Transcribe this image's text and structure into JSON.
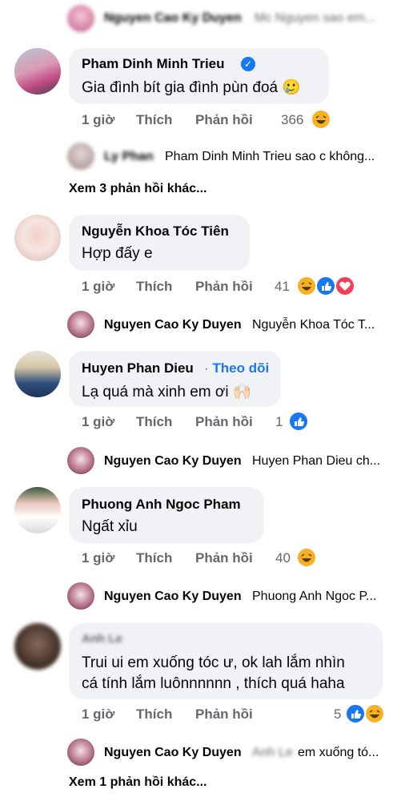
{
  "top_reply": {
    "name": "Nguyen Cao Ky Duyen",
    "text": "Mc Nguyen sao em..."
  },
  "comments": [
    {
      "name": "Pham Dinh Minh Trieu",
      "verified": true,
      "text": "Gia đình bít gia đình pùn đoá 🥲",
      "time": "1 giờ",
      "like": "Thích",
      "reply": "Phản hồi",
      "count": "366",
      "reply_preview": {
        "name": "Ly Phan",
        "text": "Pham Dinh Minh Trieu sao c không..."
      },
      "more": "Xem 3 phản hồi khác..."
    },
    {
      "name": "Nguyễn Khoa Tóc Tiên",
      "text": "Hợp đấy e",
      "time": "1 giờ",
      "like": "Thích",
      "reply": "Phản hồi",
      "count": "41",
      "reply_preview": {
        "name": "Nguyen Cao Ky Duyen",
        "text": "Nguyễn Khoa Tóc T..."
      }
    },
    {
      "name": "Huyen Phan Dieu",
      "follow": "Theo dõi",
      "text": "Lạ quá mà xinh em ơi 🙌🏻",
      "time": "1 giờ",
      "like": "Thích",
      "reply": "Phản hồi",
      "count": "1",
      "reply_preview": {
        "name": "Nguyen Cao Ky Duyen",
        "text": "Huyen Phan Dieu ch..."
      }
    },
    {
      "name": "Phuong Anh Ngoc Pham",
      "text": "Ngất xỉu",
      "time": "1 giờ",
      "like": "Thích",
      "reply": "Phản hồi",
      "count": "40",
      "reply_preview": {
        "name": "Nguyen Cao Ky Duyen",
        "text": "Phuong Anh Ngoc P..."
      }
    },
    {
      "name": "Anh Le",
      "text_line1": "Trui ui em xuống tóc ư, ok lah lắm nhìn",
      "text_line2": "cá tính lắm luônnnnnn , thích quá haha",
      "time": "1 giờ",
      "like": "Thích",
      "reply": "Phản hồi",
      "count": "5",
      "reply_preview": {
        "name": "Nguyen Cao Ky Duyen",
        "mention": "Anh Le",
        "text": "em xuống tó..."
      },
      "more": "Xem 1 phản hồi khác..."
    }
  ],
  "colors": {
    "bubble": "#f0f2f5",
    "meta": "#65676b",
    "link": "#1877f2",
    "haha": "#f7b125",
    "like": "#1877f2",
    "love": "#f33e58"
  }
}
